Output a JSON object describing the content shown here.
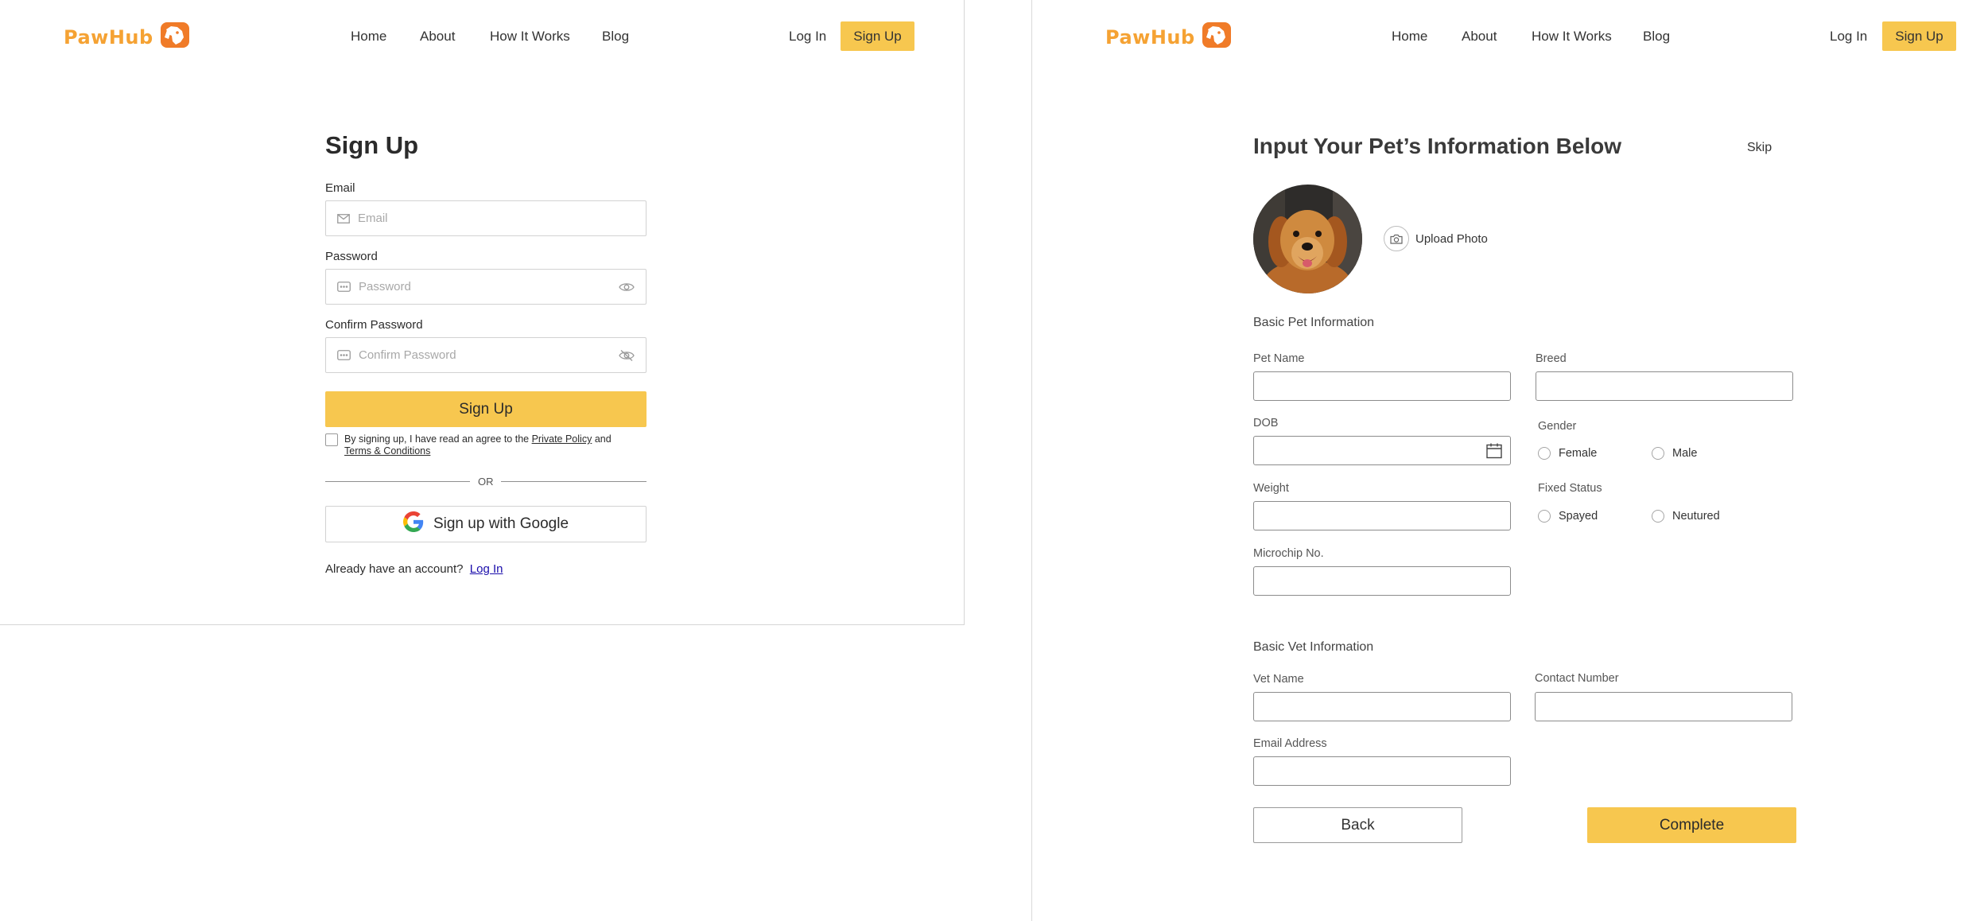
{
  "brand": {
    "name": "PawHub",
    "accent": "#f7c74f",
    "logo_color": "#f5a233"
  },
  "nav": {
    "links": [
      "Home",
      "About",
      "How It Works",
      "Blog"
    ],
    "login_label": "Log In",
    "signup_label": "Sign Up"
  },
  "signup_form": {
    "title": "Sign Up",
    "email": {
      "label": "Email",
      "placeholder": "Email",
      "icon": "mail-icon"
    },
    "password": {
      "label": "Password",
      "placeholder": "Password",
      "icon": "password-dots-icon",
      "toggle_icon": "eye-icon"
    },
    "confirm_password": {
      "label": "Confirm Password",
      "placeholder": "Confirm Password",
      "icon": "password-dots-icon",
      "toggle_icon": "eye-off-icon"
    },
    "submit_label": "Sign Up",
    "terms": {
      "prefix": "By signing up, I have read an agree to the",
      "privacy_link": "Private Policy",
      "conjunction": "and",
      "terms_link": "Terms & Conditions",
      "checked": false
    },
    "or_text": "OR",
    "google_label": "Sign up with Google",
    "already_text": "Already have an account?",
    "login_link": "Log In"
  },
  "pet_form": {
    "title": "Input Your Pet’s Information Below",
    "skip_label": "Skip",
    "upload_label": "Upload Photo",
    "basic_pet_section": "Basic Pet Information",
    "pet_name_label": "Pet Name",
    "breed_label": "Breed",
    "dob_label": "DOB",
    "gender_label": "Gender",
    "gender_options": [
      "Female",
      "Male"
    ],
    "weight_label": "Weight",
    "fixed_status_label": "Fixed Status",
    "fixed_options": [
      "Spayed",
      "Neutured"
    ],
    "microchip_label": "Microchip No.",
    "basic_vet_section": "Basic Vet Information",
    "vet_name_label": "Vet Name",
    "contact_label": "Contact Number",
    "email_label": "Email Address",
    "back_label": "Back",
    "complete_label": "Complete"
  }
}
